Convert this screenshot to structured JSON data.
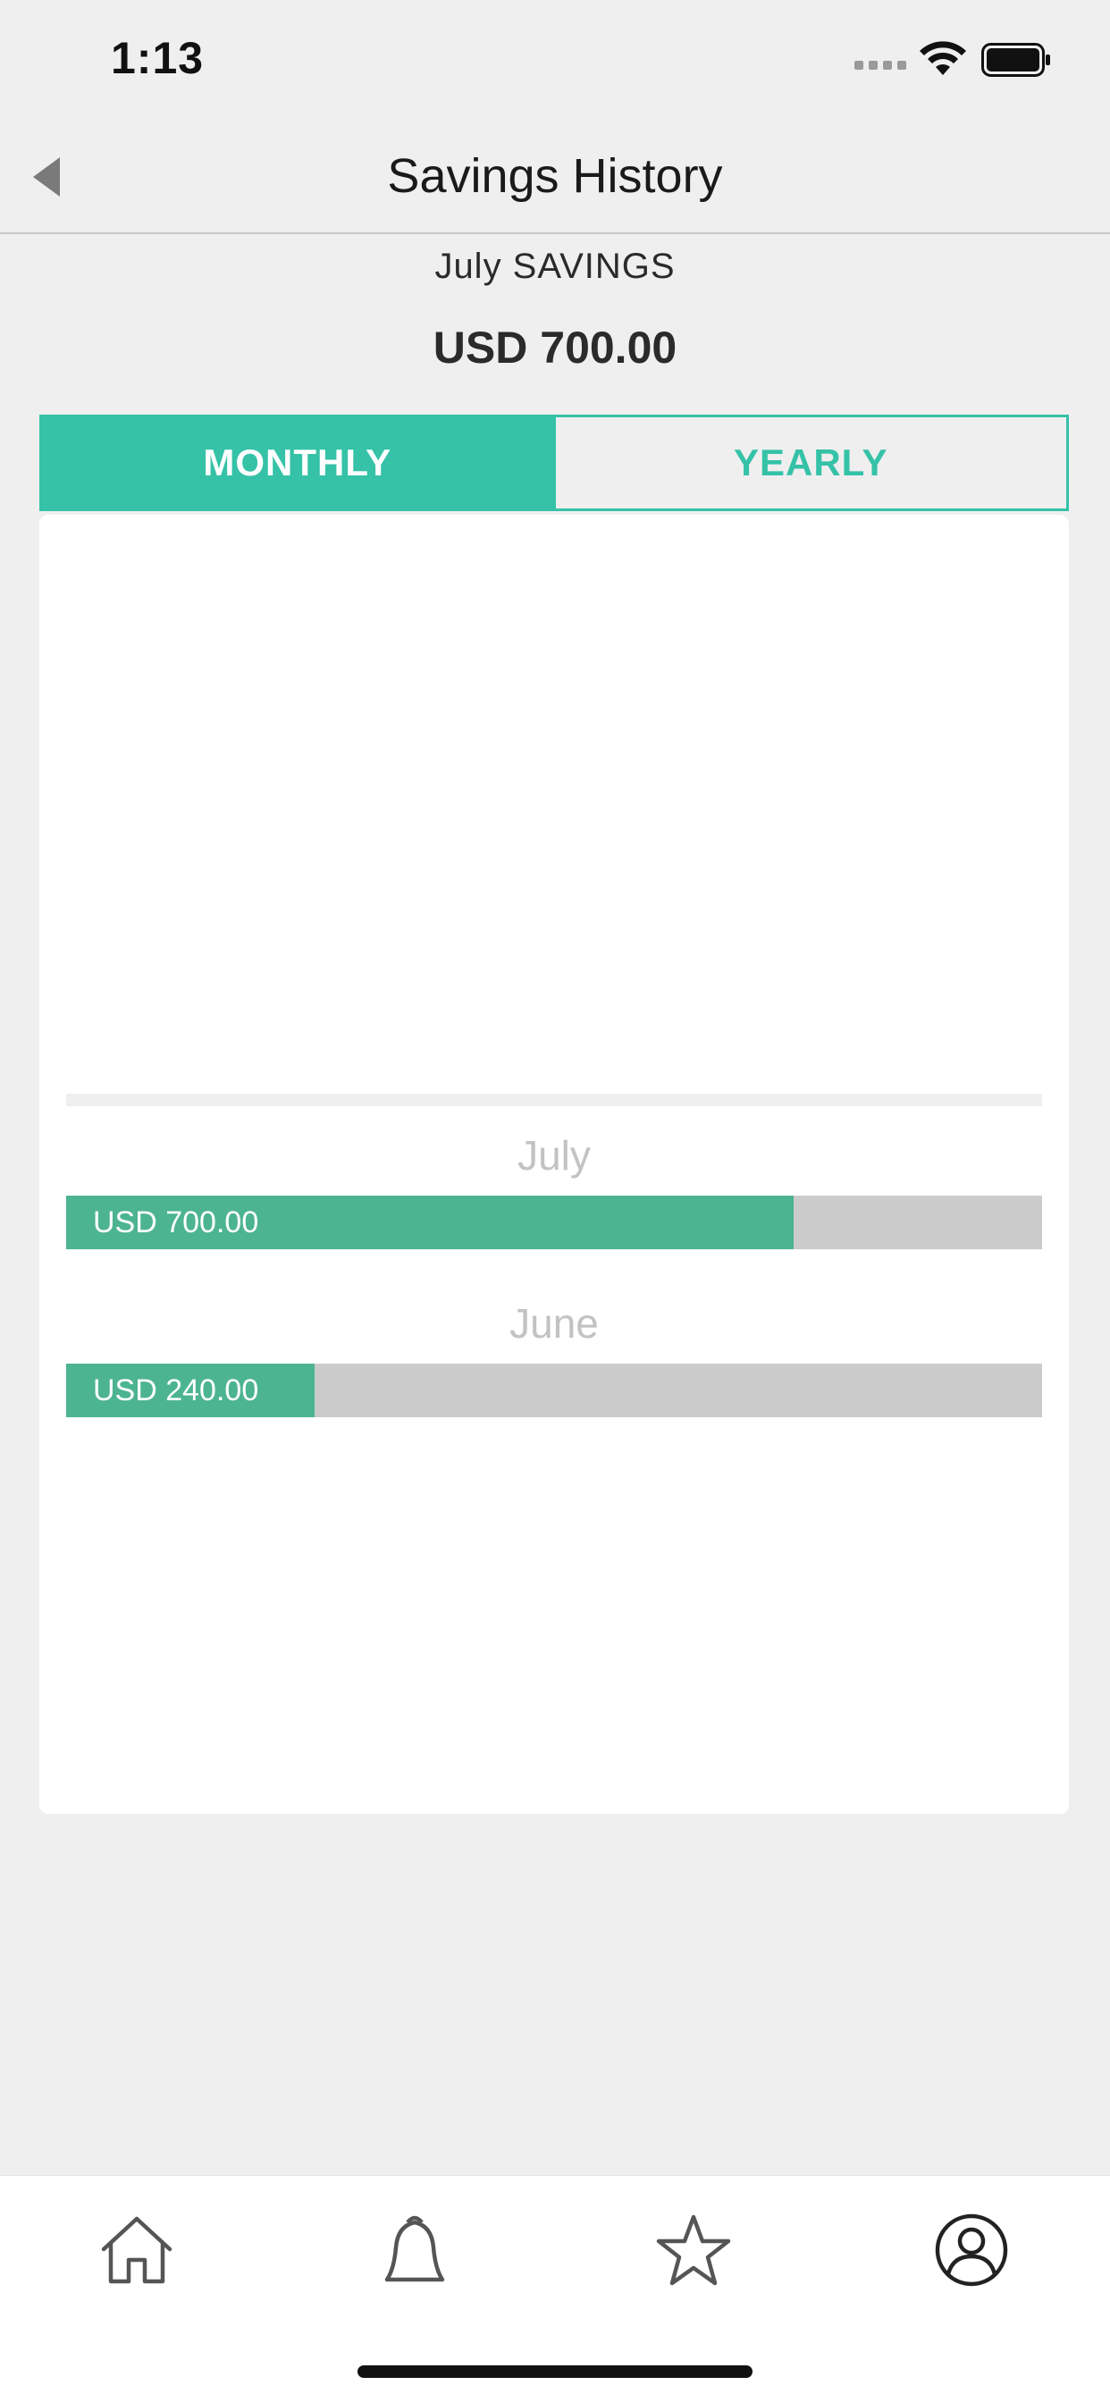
{
  "status_bar": {
    "time": "1:13"
  },
  "header": {
    "title": "Savings History",
    "back_icon": "back-triangle-icon"
  },
  "summary": {
    "period_label": "July SAVINGS",
    "total": "USD 700.00"
  },
  "tabs": [
    {
      "label": "MONTHLY",
      "active": true
    },
    {
      "label": "YEARLY",
      "active": false
    }
  ],
  "history": [
    {
      "month": "July",
      "amount_label": "USD 700.00",
      "fill_fraction": 0.745
    },
    {
      "month": "June",
      "amount_label": "USD 240.00",
      "fill_fraction": 0.255
    }
  ],
  "tab_bar": {
    "items": [
      {
        "icon": "home-icon"
      },
      {
        "icon": "bell-icon"
      },
      {
        "icon": "star-icon"
      },
      {
        "icon": "profile-icon"
      }
    ]
  },
  "colors": {
    "accent": "#35c2a7",
    "bar_fill": "#4db491",
    "bar_track": "#cbcbcb",
    "background": "#efefef"
  }
}
